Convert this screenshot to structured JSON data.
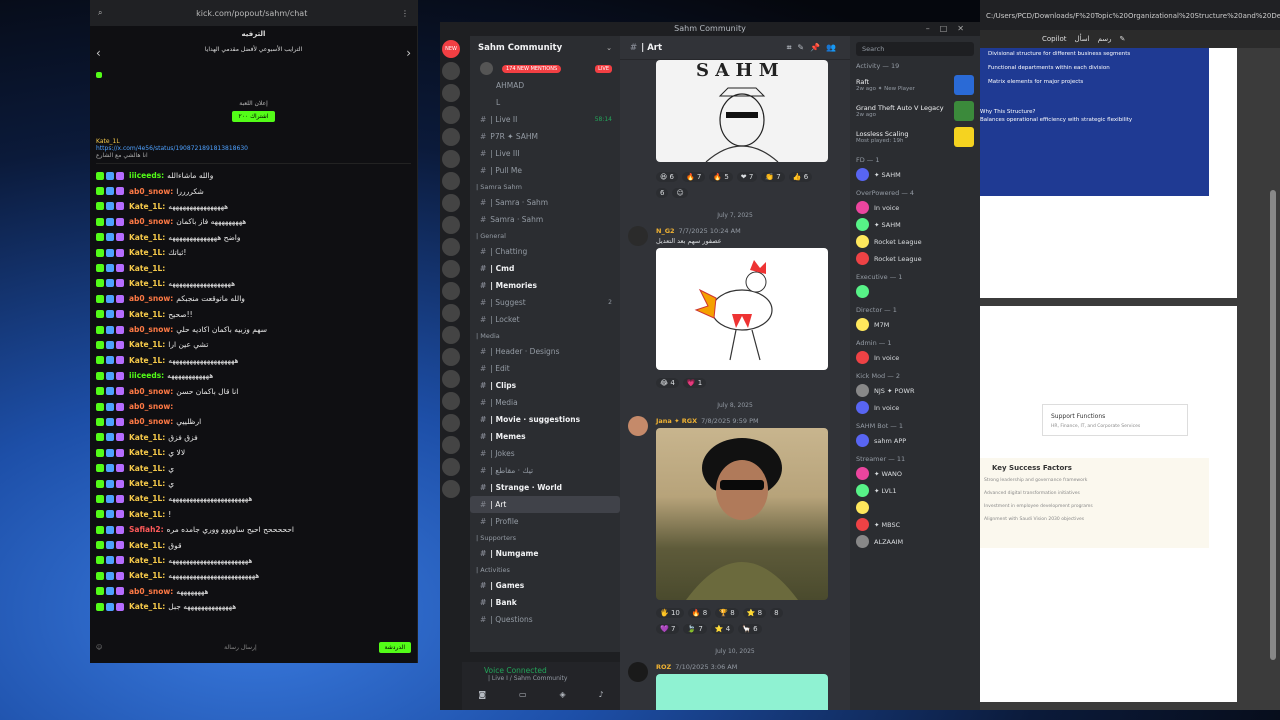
{
  "kick": {
    "url": "kick.com/popout/sahm/chat",
    "header_title": "الترفيه",
    "header_sub": "الترايب الأسبوعي لأفضل مقدمي الهدايا",
    "tab_hint": "إعلان اللعبة",
    "pinned_user": "Kate_1L",
    "pinned_link": "https://x.com/4e56/status/1908721891813818630",
    "pinned_sub": "انا هالشي مع الشارع",
    "announce_btn": "اشتراك ٢٠٠",
    "input_placeholder": "إرسال رسالة",
    "send_label": "الدردشة",
    "messages": [
      {
        "user": "iiiceeds:",
        "text": "والله ماشاءالله",
        "color": "#53fc18"
      },
      {
        "user": "ab0_snow:",
        "text": "شكررررا",
        "color": "#ff7a45"
      },
      {
        "user": "Kate_1L:",
        "text": "ههههههههههههههههه",
        "color": "#f5c94a"
      },
      {
        "user": "ab0_snow:",
        "text": "هههههههههه فاز باكمان",
        "color": "#ff7a45"
      },
      {
        "user": "Kate_1L:",
        "text": "واضح ههههههههههههههه",
        "color": "#f5c94a"
      },
      {
        "user": "Kate_1L:",
        "text": "ثباتك!",
        "color": "#f5c94a"
      },
      {
        "user": "Kate_1L:",
        "text": "",
        "color": "#f5c94a"
      },
      {
        "user": "Kate_1L:",
        "text": "ههههههههههههههههههه",
        "color": "#f5c94a"
      },
      {
        "user": "ab0_snow:",
        "text": "والله ماتوقعت منجبكم",
        "color": "#ff7a45"
      },
      {
        "user": "Kate_1L:",
        "text": "صحيح!!",
        "color": "#f5c94a"
      },
      {
        "user": "ab0_snow:",
        "text": "سهم وزبيه باكمان اكاديه حلي",
        "color": "#ff7a45"
      },
      {
        "user": "Kate_1L:",
        "text": "تشي عين ارا",
        "color": "#f5c94a"
      },
      {
        "user": "Kate_1L:",
        "text": "هههههههههههههههههههه",
        "color": "#f5c94a"
      },
      {
        "user": "iiiceeds:",
        "text": "ههههههههههههه",
        "color": "#53fc18"
      },
      {
        "user": "ab0_snow:",
        "text": "انا قال باكمان حسن",
        "color": "#ff7a45"
      },
      {
        "user": "ab0_snow:",
        "text": "",
        "color": "#ff7a45"
      },
      {
        "user": "ab0_snow:",
        "text": "ارظلييي",
        "color": "#ff7a45"
      },
      {
        "user": "Kate_1L:",
        "text": "فزق فزق",
        "color": "#f5c94a"
      },
      {
        "user": "Kate_1L:",
        "text": "لالا ي",
        "color": "#f5c94a"
      },
      {
        "user": "Kate_1L:",
        "text": "ي",
        "color": "#f5c94a"
      },
      {
        "user": "Kate_1L:",
        "text": "ي",
        "color": "#f5c94a"
      },
      {
        "user": "Kate_1L:",
        "text": "هههههههههههههههههههههههه",
        "color": "#f5c94a"
      },
      {
        "user": "Kate_1L:",
        "text": "!",
        "color": "#f5c94a"
      },
      {
        "user": "Safiah2:",
        "text": "احححححح احبح ساوووو ووري جامده مره",
        "color": "#ff5a5a"
      },
      {
        "user": "Kate_1L:",
        "text": "قوق",
        "color": "#f5c94a"
      },
      {
        "user": "Kate_1L:",
        "text": "هههههههههههههههههههههههه",
        "color": "#f5c94a"
      },
      {
        "user": "Kate_1L:",
        "text": "هههههههههههههههههههههههههه",
        "color": "#f5c94a"
      },
      {
        "user": "ab0_snow:",
        "text": "ههههههههه",
        "color": "#ff7a45"
      },
      {
        "user": "Kate_1L:",
        "text": "ههههههههههههههه جبل",
        "color": "#f5c94a"
      }
    ]
  },
  "discord": {
    "window_title": "Sahm Community",
    "server_name": "Sahm Community",
    "mentions_pill": "174 NEW MENTIONS",
    "live_pill": "LIVE",
    "voice_users": [
      "AHMAD",
      "L"
    ],
    "channels": [
      {
        "type": "chan",
        "label": "| Live II",
        "time": "58:14"
      },
      {
        "type": "chan",
        "label": "P7R  ✦ SAHM"
      },
      {
        "type": "chan",
        "label": "| Live III"
      },
      {
        "type": "chan",
        "label": "| Pull Me"
      },
      {
        "type": "cat",
        "label": "| Samra Sahm"
      },
      {
        "type": "chan",
        "label": "| Samra · Sahm"
      },
      {
        "type": "chan",
        "label": "Samra · Sahm"
      },
      {
        "type": "cat",
        "label": "| General"
      },
      {
        "type": "chan",
        "label": "| Chatting"
      },
      {
        "type": "chan",
        "label": "| Cmd",
        "bold": true
      },
      {
        "type": "chan",
        "label": "| Memories",
        "bold": true
      },
      {
        "type": "chan",
        "label": "| Suggest",
        "count": "2"
      },
      {
        "type": "chan",
        "label": "| Locket"
      },
      {
        "type": "cat",
        "label": "| Media"
      },
      {
        "type": "chan",
        "label": "| Header · Designs"
      },
      {
        "type": "chan",
        "label": "| Edit"
      },
      {
        "type": "chan",
        "label": "| Clips",
        "bold": true
      },
      {
        "type": "chan",
        "label": "| Media"
      },
      {
        "type": "chan",
        "label": "| Movie · suggestions",
        "bold": true
      },
      {
        "type": "chan",
        "label": "| Memes",
        "bold": true
      },
      {
        "type": "chan",
        "label": "| Jokes"
      },
      {
        "type": "chan",
        "label": "| تيك · مقاطع"
      },
      {
        "type": "chan",
        "label": "| Strange · World",
        "bold": true
      },
      {
        "type": "chan",
        "label": "| Art",
        "active": true
      },
      {
        "type": "chan",
        "label": "| Profile"
      },
      {
        "type": "cat",
        "label": "| Supporters"
      },
      {
        "type": "chan",
        "label": "| Numgame",
        "bold": true
      },
      {
        "type": "cat",
        "label": "| Activities"
      },
      {
        "type": "chan",
        "label": "| Games",
        "bold": true
      },
      {
        "type": "chan",
        "label": "| Bank",
        "bold": true
      },
      {
        "type": "chan",
        "label": "| Questions"
      }
    ],
    "voice_connected": "Voice Connected",
    "voice_sub": "| Live I / Sahm Community",
    "channel_header": "| Art",
    "search_placeholder": "Search",
    "date_seps": [
      "July 7, 2025",
      "July 8, 2025",
      "July 10, 2025"
    ],
    "posts": [
      {
        "author": "N_G2",
        "time": "7/7/2025 10:24 AM",
        "caption": "عصفور سهم بعد التعديل"
      },
      {
        "author": "Jana  ✦ RGX",
        "time": "7/8/2025 9:59 PM",
        "caption": ""
      },
      {
        "author": "ROZ",
        "time": "7/10/2025 3:06 AM",
        "caption": ""
      }
    ],
    "reacts_1": [
      "😆 6",
      "🔥 7",
      "🔥 5",
      "❤ 7",
      "👏 7",
      "👍 6",
      "6"
    ],
    "reacts_2": [
      "😂 4",
      "💗 1"
    ],
    "reacts_3a": [
      "🖐 10",
      "🔥 8",
      "🏆 8",
      "⭐ 8",
      "8"
    ],
    "reacts_3b": [
      "💜 7",
      "🍃 7",
      "⭐ 4",
      "🦙 6"
    ],
    "activity_label": "Activity — 19",
    "activities": [
      {
        "name": "Raft",
        "sub": "2w ago  ✦ New Player",
        "color": "#2a6ad6"
      },
      {
        "name": "Grand Theft Auto V Legacy",
        "sub": "2w ago",
        "color": "#3b8a3b"
      },
      {
        "name": "Lossless Scaling",
        "sub": "Most played: 19h",
        "color": "#f5d320"
      }
    ],
    "groups": [
      {
        "label": "FD — 1",
        "members": [
          "✦ SAHM"
        ]
      },
      {
        "label": "OverPowered — 4",
        "members": [
          "In voice",
          "✦ SAHM",
          "Rocket League",
          "Rocket League"
        ]
      },
      {
        "label": "Executive — 1",
        "members": [
          ""
        ]
      },
      {
        "label": "Director — 1",
        "members": [
          "M7M"
        ]
      },
      {
        "label": "Admin — 1",
        "members": [
          "In voice"
        ]
      },
      {
        "label": "Kick Mod — 2",
        "members": [
          "NJS ✦ POWR",
          "In voice"
        ]
      },
      {
        "label": "SAHM Bot — 1",
        "members": [
          "sahm  APP"
        ]
      },
      {
        "label": "Streamer — 11",
        "members": [
          "✦ WANO",
          "✦ LVL1",
          "",
          "✦ MBSC",
          "ALZAAIM"
        ]
      }
    ]
  },
  "pdf": {
    "url": "C:/Users/PCD/Downloads/F%20Topic%20Organizational%20Structure%20and%20Design%20(5).pdf",
    "toolbar_copilot": "Copilot",
    "toolbar_ask": "اسأل",
    "toolbar_draw": "رسم",
    "blue_lines": [
      "Divisional structure for different business segments",
      "Functional departments within each division",
      "Matrix elements for major projects"
    ],
    "why_title": "Why This Structure?",
    "why_text": "Balances operational efficiency with strategic flexibility",
    "support_title": "Support Functions",
    "support_sub": "HR, Finance, IT, and Corporate Services",
    "ksf_title": "Key Success Factors",
    "ksf_items": [
      "Strong leadership and governance framework",
      "Advanced digital transformation initiatives",
      "Investment in employee development programs",
      "Alignment with Saudi Vision 2030 objectives"
    ]
  }
}
